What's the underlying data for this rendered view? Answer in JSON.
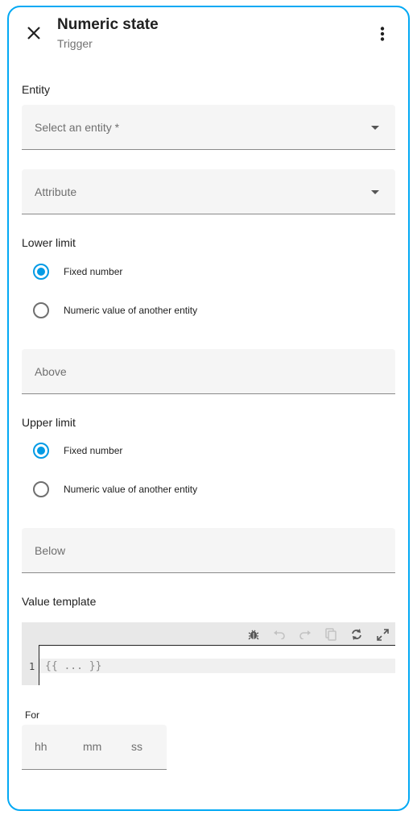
{
  "header": {
    "title": "Numeric state",
    "subtitle": "Trigger"
  },
  "entity": {
    "label": "Entity",
    "placeholder": "Select an entity *"
  },
  "attribute": {
    "placeholder": "Attribute"
  },
  "lower_limit": {
    "label": "Lower limit",
    "options": [
      "Fixed number",
      "Numeric value of another entity"
    ],
    "selected": "Fixed number",
    "input_placeholder": "Above"
  },
  "upper_limit": {
    "label": "Upper limit",
    "options": [
      "Fixed number",
      "Numeric value of another entity"
    ],
    "selected": "Fixed number",
    "input_placeholder": "Below"
  },
  "value_template": {
    "label": "Value template",
    "line_number": "1",
    "code": "{{ ... }}",
    "toolbar_icons": [
      "bug-icon",
      "undo-icon",
      "redo-icon",
      "copy-icon",
      "refresh-icon",
      "fullscreen-icon"
    ]
  },
  "for": {
    "label": "For",
    "hours": "hh",
    "minutes": "mm",
    "seconds": "ss"
  },
  "colors": {
    "accent": "#039be5",
    "border": "#03a9f4",
    "field_bg": "#f5f5f5"
  }
}
